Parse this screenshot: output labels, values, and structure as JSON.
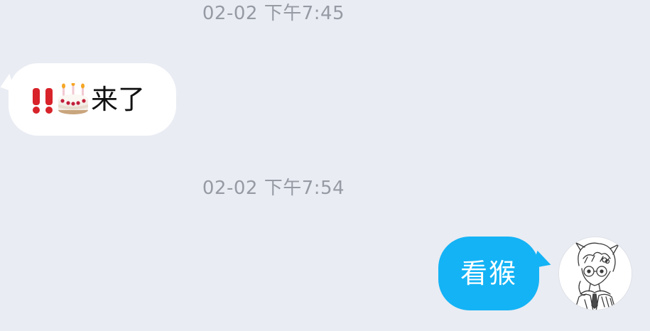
{
  "messages": [
    {
      "timestamp": "02-02 下午7:45",
      "direction": "incoming",
      "icons": [
        "double-exclamation-icon",
        "birthday-cake-icon"
      ],
      "text": "来了"
    },
    {
      "timestamp": "02-02 下午7:54",
      "direction": "outgoing",
      "text": "看猴"
    }
  ],
  "colors": {
    "background": "#e9ecf3",
    "incoming_bubble": "#ffffff",
    "outgoing_bubble": "#14b3f5",
    "timestamp_text": "#969aa3",
    "incoming_text": "#111111",
    "outgoing_text": "#ffffff"
  },
  "avatar": {
    "icon": "anime-sketch-avatar"
  }
}
